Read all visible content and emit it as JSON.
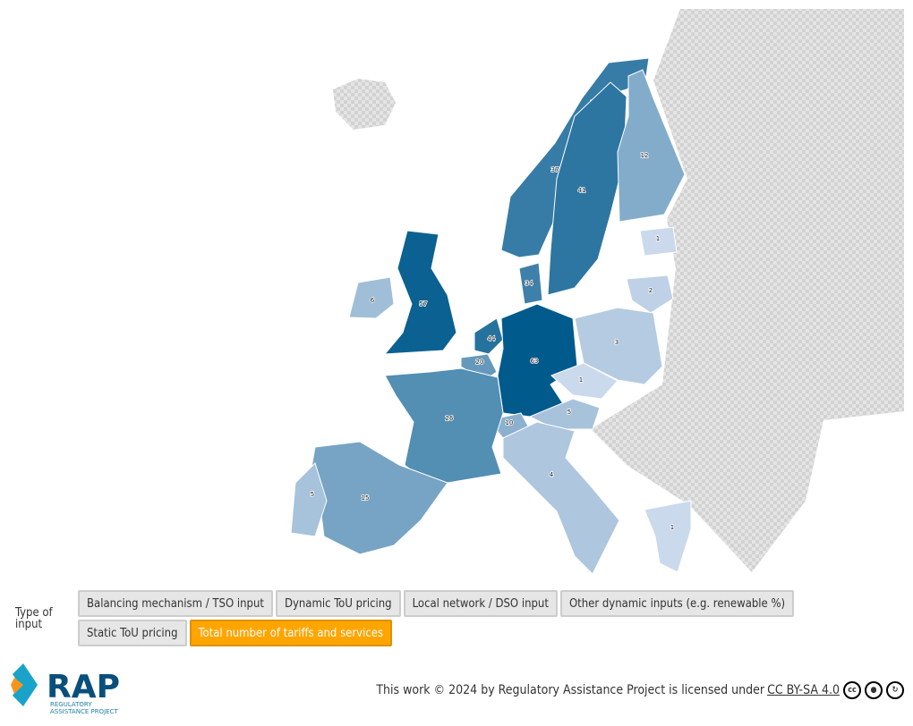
{
  "map": {
    "color_min": "#e8ebfa",
    "color_max": "#005a8c",
    "no_data_color": "#d9d9d9",
    "countries": [
      {
        "name": "Norway",
        "value": 37
      },
      {
        "name": "Sweden",
        "value": 41
      },
      {
        "name": "Finland",
        "value": 12
      },
      {
        "name": "Estonia",
        "value": 1
      },
      {
        "name": "Lithuania",
        "value": 2
      },
      {
        "name": "Denmark",
        "value": 34
      },
      {
        "name": "Ireland",
        "value": 6
      },
      {
        "name": "United Kingdom",
        "value": 57
      },
      {
        "name": "Netherlands",
        "value": 44
      },
      {
        "name": "Belgium",
        "value": 20
      },
      {
        "name": "Germany",
        "value": 63
      },
      {
        "name": "Poland",
        "value": 3
      },
      {
        "name": "Czechia",
        "value": 1
      },
      {
        "name": "Austria",
        "value": 5
      },
      {
        "name": "Switzerland",
        "value": 10
      },
      {
        "name": "France",
        "value": 26
      },
      {
        "name": "Italy",
        "value": 4
      },
      {
        "name": "Spain",
        "value": 15
      },
      {
        "name": "Portugal",
        "value": 5
      },
      {
        "name": "Greece",
        "value": 1
      }
    ]
  },
  "controls": {
    "label": "Type of input",
    "buttons": [
      {
        "label": "Balancing mechanism / TSO input",
        "active": false
      },
      {
        "label": "Dynamic ToU pricing",
        "active": false
      },
      {
        "label": "Local network / DSO input",
        "active": false
      },
      {
        "label": "Other dynamic inputs (e.g. renewable %)",
        "active": false
      },
      {
        "label": "Static ToU pricing",
        "active": false
      },
      {
        "label": "Total number of tariffs and services",
        "active": true
      }
    ]
  },
  "logo": {
    "text": "RAP",
    "subtitle": "REGULATORY ASSISTANCE PROJECT"
  },
  "footer": {
    "credit": "This work © 2024 by Regulatory Assistance Project is licensed under",
    "license_link": "CC BY-SA 4.0",
    "license_icons": [
      "cc-icon",
      "by-icon",
      "sa-icon"
    ]
  }
}
